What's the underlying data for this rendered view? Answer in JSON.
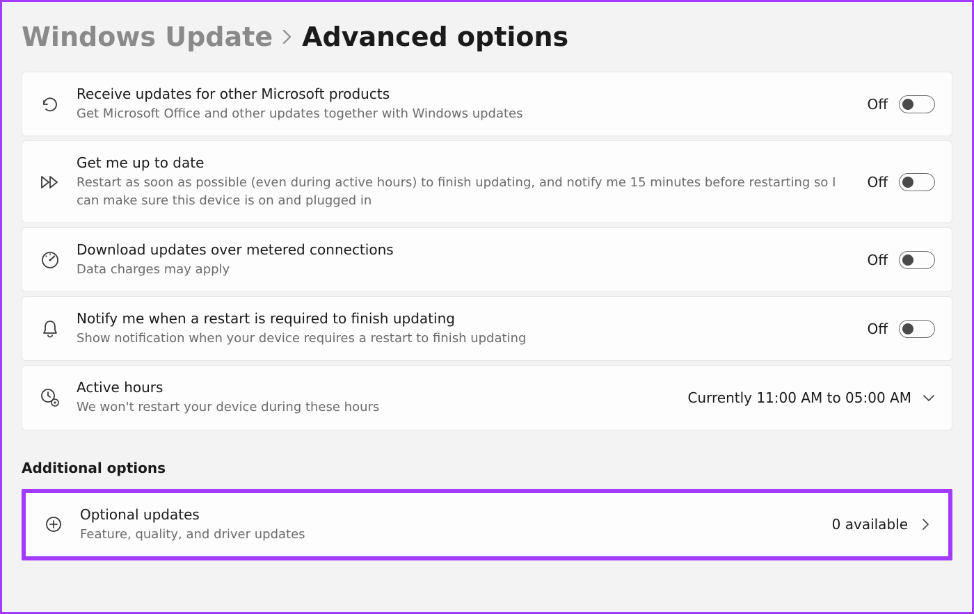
{
  "breadcrumb": {
    "parent": "Windows Update",
    "current": "Advanced options"
  },
  "settings": [
    {
      "icon": "history-icon",
      "title": "Receive updates for other Microsoft products",
      "desc": "Get Microsoft Office and other updates together with Windows updates",
      "state_label": "Off"
    },
    {
      "icon": "fast-forward-icon",
      "title": "Get me up to date",
      "desc": "Restart as soon as possible (even during active hours) to finish updating, and notify me 15 minutes before restarting so I can make sure this device is on and plugged in",
      "state_label": "Off"
    },
    {
      "icon": "gauge-icon",
      "title": "Download updates over metered connections",
      "desc": "Data charges may apply",
      "state_label": "Off"
    },
    {
      "icon": "bell-icon",
      "title": "Notify me when a restart is required to finish updating",
      "desc": "Show notification when your device requires a restart to finish updating",
      "state_label": "Off"
    }
  ],
  "active_hours": {
    "title": "Active hours",
    "desc": "We won't restart your device during these hours",
    "value": "Currently 11:00 AM to 05:00 AM"
  },
  "additional_heading": "Additional options",
  "optional_updates": {
    "title": "Optional updates",
    "desc": "Feature, quality, and driver updates",
    "value": "0 available"
  }
}
